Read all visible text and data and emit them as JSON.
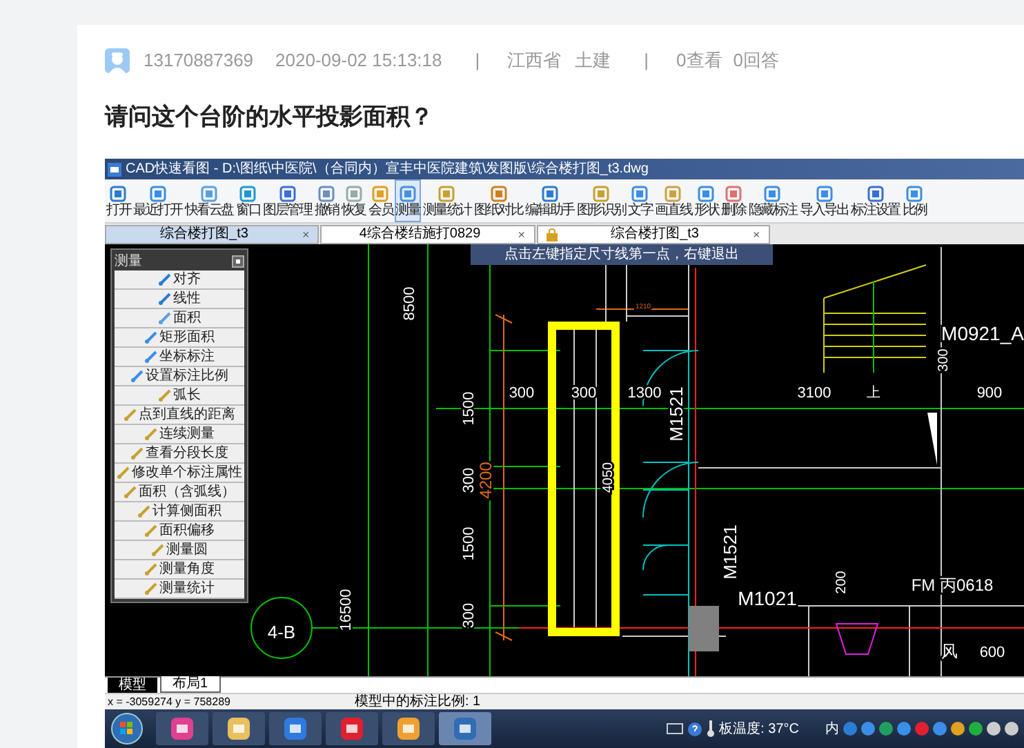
{
  "post": {
    "author": "13170887369",
    "time": "2020-09-02 15:13:18",
    "separator_1": "|",
    "province": "江西省",
    "category": "土建",
    "separator_2": "|",
    "views": "0查看",
    "answers": "0回答",
    "title": "请问这个台阶的水平投影面积？"
  },
  "screenshot": {
    "window_title": "CAD快速看图 - D:\\图纸\\中医院\\（合同内）宣丰中医院建筑\\发图版\\综合楼打图_t3.dwg",
    "toolbar": [
      {
        "label": "打开",
        "selected": false
      },
      {
        "label": "最近打开",
        "selected": false
      },
      {
        "label": "快看云盘",
        "selected": false
      },
      {
        "label": "窗口",
        "selected": false
      },
      {
        "label": "图层管理",
        "selected": false
      },
      {
        "label": "撤销",
        "selected": false
      },
      {
        "label": "恢复",
        "selected": false
      },
      {
        "label": "会员",
        "selected": false
      },
      {
        "label": "测量",
        "selected": true
      },
      {
        "label": "测量统计",
        "selected": false
      },
      {
        "label": "图纸对比",
        "selected": false
      },
      {
        "label": "编辑助手",
        "selected": false
      },
      {
        "label": "图形识别",
        "selected": false
      },
      {
        "label": "文字",
        "selected": false
      },
      {
        "label": "画直线",
        "selected": false
      },
      {
        "label": "形状",
        "selected": false
      },
      {
        "label": "删除",
        "selected": false
      },
      {
        "label": "隐藏标注",
        "selected": false
      },
      {
        "label": "导入导出",
        "selected": false
      },
      {
        "label": "标注设置",
        "selected": false
      },
      {
        "label": "比例",
        "selected": false
      }
    ],
    "tabs": [
      {
        "label": "综合楼打图_t3",
        "close": "×",
        "selected": true,
        "locked": false
      },
      {
        "label": "4综合楼结施打0829",
        "close": "×",
        "selected": false,
        "locked": false
      },
      {
        "label": "综合楼打图_t3",
        "close": "×",
        "selected": false,
        "locked": true
      }
    ],
    "measure_panel": {
      "title": "测量",
      "items": [
        "对齐",
        "线性",
        "面积",
        "矩形面积",
        "坐标标注",
        "设置标注比例",
        "弧长",
        "点到直线的距离",
        "连续测量",
        "查看分段长度",
        "修改单个标注属性",
        "面积（含弧线）",
        "计算侧面积",
        "面积偏移",
        "测量圆",
        "测量角度",
        "测量统计"
      ]
    },
    "tooltip": "点击左键指定尺寸线第一点，右键退出",
    "drawing_labels": [
      {
        "text": "8500",
        "color": "#ffffff"
      },
      {
        "text": "16500",
        "color": "#ffffff"
      },
      {
        "text": "4-B",
        "color": "#ffffff"
      },
      {
        "text": "1500",
        "color": "#ffffff"
      },
      {
        "text": "300",
        "color": "#ffffff"
      },
      {
        "text": "1500",
        "color": "#ffffff"
      },
      {
        "text": "300",
        "color": "#ffffff"
      },
      {
        "text": "4200",
        "color": "#e06a10"
      },
      {
        "text": "300",
        "color": "#ffffff"
      },
      {
        "text": "300",
        "color": "#ffffff"
      },
      {
        "text": "1300",
        "color": "#ffffff"
      },
      {
        "text": "4050",
        "color": "#ffffff"
      },
      {
        "text": "M1521",
        "color": "#ffffff"
      },
      {
        "text": "M1521",
        "color": "#ffffff"
      },
      {
        "text": "M1021",
        "color": "#ffffff"
      },
      {
        "text": "M0921_A",
        "color": "#ffffff"
      },
      {
        "text": "3100",
        "color": "#ffffff"
      },
      {
        "text": "300",
        "color": "#ffffff"
      },
      {
        "text": "900",
        "color": "#ffffff"
      },
      {
        "text": "FM 丙0618",
        "color": "#ffffff"
      },
      {
        "text": "1210",
        "color": "#e06a10"
      },
      {
        "text": "上",
        "color": "#ffffff"
      },
      {
        "text": "200",
        "color": "#ffffff"
      },
      {
        "text": "600",
        "color": "#ffffff"
      },
      {
        "text": "风",
        "color": "#ffffff"
      }
    ],
    "layout_tabs": [
      {
        "label": "模型",
        "selected": true
      },
      {
        "label": "布局1",
        "selected": false
      }
    ],
    "status": {
      "coords": "x = -3059274  y = 758289",
      "scale": "模型中的标注比例: 1"
    },
    "taskbar": {
      "temperature": "板温度: 37°C",
      "ime": "内"
    }
  }
}
